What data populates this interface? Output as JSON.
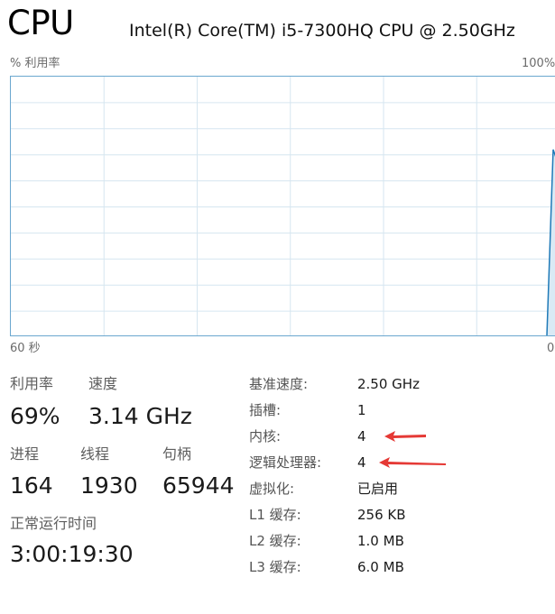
{
  "header": {
    "title": "CPU",
    "model": "Intel(R) Core(TM) i5-7300HQ CPU @ 2.50GHz"
  },
  "graph": {
    "y_label": "% 利用率",
    "y_max_label": "100%",
    "x_left_label": "60 秒",
    "x_right_label": "0",
    "line_color": "#1f7ab8",
    "fill_color": "#d9eaf5",
    "grid_color": "#d6e6f0"
  },
  "chart_data": {
    "type": "area",
    "x_range_seconds": [
      60,
      0
    ],
    "ylim": [
      0,
      100
    ],
    "points": [
      {
        "x": 1.0,
        "y": 0
      },
      {
        "x": 0.3,
        "y": 72
      },
      {
        "x": 0.0,
        "y": 69
      }
    ]
  },
  "stats": {
    "utilization_label": "利用率",
    "utilization_value": "69%",
    "speed_label": "速度",
    "speed_value": "3.14 GHz",
    "processes_label": "进程",
    "processes_value": "164",
    "threads_label": "线程",
    "threads_value": "1930",
    "handles_label": "句柄",
    "handles_value": "65944",
    "uptime_label": "正常运行时间",
    "uptime_value": "3:00:19:30"
  },
  "info": {
    "base_speed_label": "基准速度:",
    "base_speed_value": "2.50 GHz",
    "sockets_label": "插槽:",
    "sockets_value": "1",
    "cores_label": "内核:",
    "cores_value": "4",
    "logical_label": "逻辑处理器:",
    "logical_value": "4",
    "virtualization_label": "虚拟化:",
    "virtualization_value": "已启用",
    "l1_label": "L1 缓存:",
    "l1_value": "256 KB",
    "l2_label": "L2 缓存:",
    "l2_value": "1.0 MB",
    "l3_label": "L3 缓存:",
    "l3_value": "6.0 MB"
  },
  "annotations": {
    "arrow_color": "#e53935"
  }
}
